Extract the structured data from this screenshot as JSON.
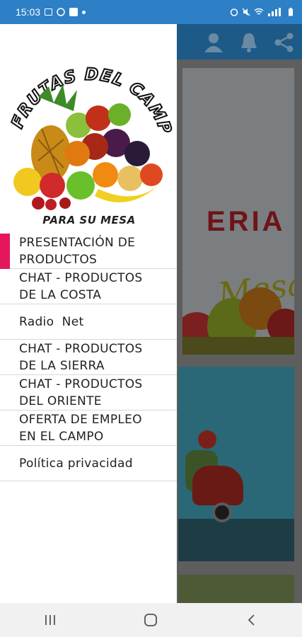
{
  "status_bar": {
    "time": "15:03",
    "left_icons": [
      "image-icon",
      "whatsapp-icon",
      "facebook-icon",
      "dot-icon"
    ],
    "right_icons": [
      "alarm-icon",
      "mute-icon",
      "wifi-icon",
      "signal-icon",
      "battery-icon"
    ],
    "color": "#2d7fc6"
  },
  "toolbar": {
    "icons": [
      "profile-icon",
      "bell-icon",
      "share-icon"
    ],
    "color": "#1d5a88"
  },
  "logo": {
    "title": "FRUTAS DEL CAMPO",
    "subtitle": "PARA SU MESA"
  },
  "background_content": {
    "banner_text": "ERIA",
    "script_text": "Mesa"
  },
  "menu": {
    "active_color": "#e4175b",
    "items": [
      {
        "line1": "PRESENTACIÓN DE",
        "line2": "PRODUCTOS"
      },
      {
        "line1": "CHAT - PRODUCTOS",
        "line2": "DE LA COSTA"
      },
      {
        "line1": "Radio  Net",
        "line2": ""
      },
      {
        "line1": "CHAT - PRODUCTOS",
        "line2": "DE LA SIERRA"
      },
      {
        "line1": "CHAT - PRODUCTOS",
        "line2": "DEL ORIENTE"
      },
      {
        "line1": "OFERTA DE EMPLEO",
        "line2": "EN EL CAMPO"
      },
      {
        "line1": "Política privacidad",
        "line2": ""
      }
    ]
  },
  "nav_bar": {
    "buttons": [
      "recents-icon",
      "home-icon",
      "back-icon"
    ]
  }
}
